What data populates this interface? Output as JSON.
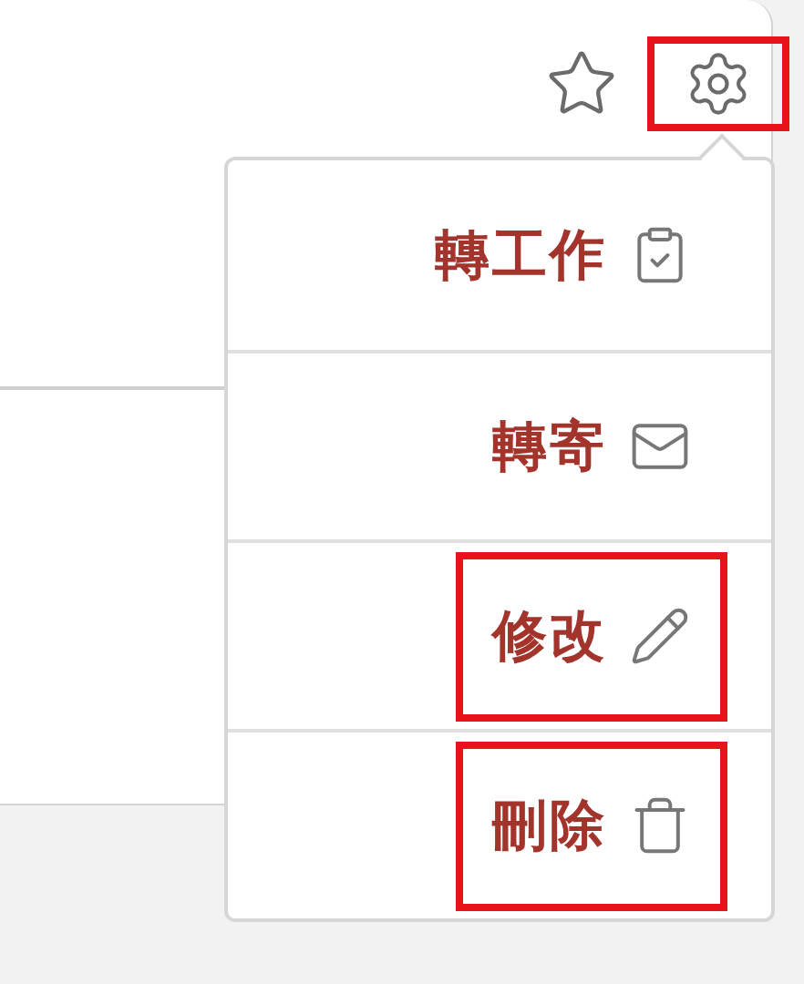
{
  "toolbar": {
    "favorite": {
      "selected": false
    },
    "settings": {
      "highlighted": true
    }
  },
  "menu": {
    "items": [
      {
        "kind": "task",
        "label": "轉工作",
        "highlighted": false
      },
      {
        "kind": "forward",
        "label": "轉寄",
        "highlighted": false
      },
      {
        "kind": "edit",
        "label": "修改",
        "highlighted": true
      },
      {
        "kind": "delete",
        "label": "刪除",
        "highlighted": true
      }
    ]
  }
}
